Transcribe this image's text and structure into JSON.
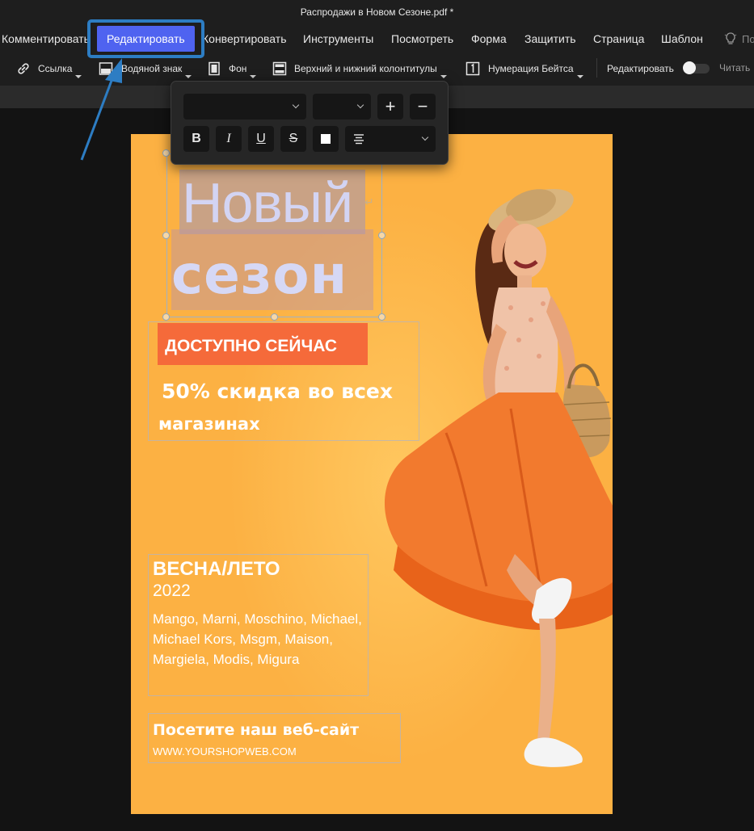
{
  "window": {
    "title": "Распродажи в Новом Сезоне.pdf *"
  },
  "menu": {
    "items": [
      {
        "label": "Комментировать"
      },
      {
        "label": "Редактировать",
        "active": true
      },
      {
        "label": "Конвертировать"
      },
      {
        "label": "Инструменты"
      },
      {
        "label": "Посмотреть"
      },
      {
        "label": "Форма"
      },
      {
        "label": "Защитить"
      },
      {
        "label": "Страница"
      },
      {
        "label": "Шаблон"
      }
    ],
    "truncated_label": "По",
    "bulb_icon": "lightbulb-icon"
  },
  "toolbar": {
    "link": "Ссылка",
    "watermark": "Водяной знак",
    "background": "Фон",
    "header_footer": "Верхний и нижний колонтитулы",
    "bates": "Нумерация Бейтса",
    "edit_mode": "Редактировать",
    "read_mode": "Читать",
    "icons": [
      "link-icon",
      "watermark-icon",
      "background-icon",
      "header-footer-icon",
      "bates-numbering-icon"
    ]
  },
  "format_popup": {
    "font_family": "",
    "font_size": "",
    "bold_glyph": "B",
    "italic_glyph": "I",
    "underline_glyph": "U",
    "strike_glyph": "S",
    "plus_glyph": "+",
    "minus_glyph": "−"
  },
  "document": {
    "headline_line1": "Новый",
    "headline_line2": "сезон",
    "pilcrow": "↵",
    "badge": "ДОСТУПНО СЕЙЧАС",
    "discount_line1": "50% скидка во всех",
    "discount_line2": "магазинах",
    "season_title": "ВЕСНА/ЛЕТО",
    "season_year": "2022",
    "brands": "Mango, Marni, Moschino, Michael, Michael Kors, Msgm, Maison, Margiela, Modis, Migura",
    "visit": "Посетите наш веб-сайт",
    "url": "WWW.YOURSHOPWEB.COM"
  },
  "colors": {
    "accent": "#4f63f0",
    "page_background": "#fcb143",
    "badge": "#f56a3a",
    "annotation": "#2d7dc3"
  }
}
